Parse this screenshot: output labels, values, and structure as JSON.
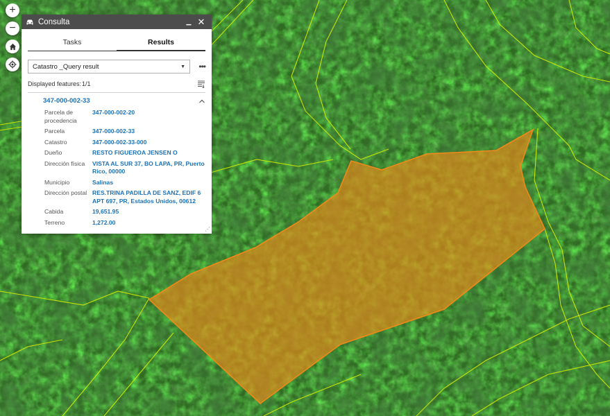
{
  "map": {
    "colors": {
      "parcel_fill": "#e8891a",
      "parcel_stroke": "#f08a18",
      "boundary": "#d8f000"
    }
  },
  "map_controls": {
    "zoom_in": "+",
    "zoom_out": "−",
    "home_icon": "home-icon",
    "locate_icon": "locate-icon"
  },
  "widget": {
    "title": "Consulta",
    "icon": "car-icon",
    "minimize": "▁",
    "close": "✕",
    "tabs": [
      "Tasks",
      "Results"
    ],
    "active_tab": "Results",
    "layer_select": {
      "value": "Catastro _Query result"
    },
    "more_options": "•••",
    "displayed_label": "Displayed features:",
    "displayed_value": "1/1",
    "feature": {
      "title": "347-000-002-33",
      "attributes": [
        {
          "key": "Parcela de procedencia",
          "value": "347-000-002-20"
        },
        {
          "key": "Parcela",
          "value": "347-000-002-33"
        },
        {
          "key": "Catastro",
          "value": "347-000-002-33-000"
        },
        {
          "key": "Dueño",
          "value": "RESTO FIGUEROA JENSEN O"
        },
        {
          "key": "Dirección física",
          "value": "VISTA AL SUR 37, BO LAPA, PR, Puerto Rico, 00000"
        },
        {
          "key": "Municipio",
          "value": "Salinas"
        },
        {
          "key": "Dirección postal",
          "value": "RES.TRINA PADILLA DE SANZ, EDIF 6 APT 697, PR, Estados Unidos, 00612"
        },
        {
          "key": "Cabida",
          "value": "19,651.95"
        },
        {
          "key": "Terreno",
          "value": "1,272.00"
        }
      ]
    }
  }
}
